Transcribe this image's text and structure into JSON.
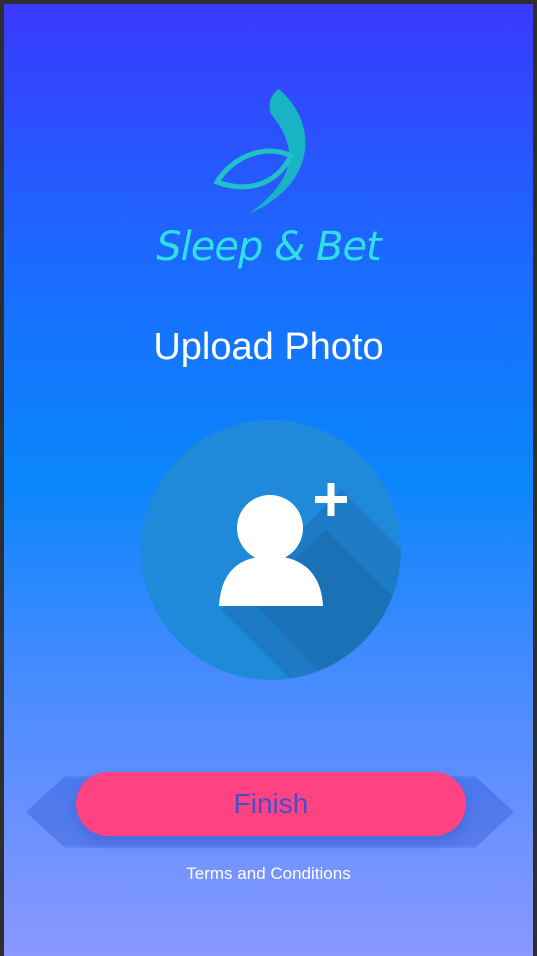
{
  "app": {
    "brand_name": "Sleep & Bet",
    "logo_icon": "butterfly-leaf-icon",
    "accent_color": "#2fe0e6"
  },
  "main": {
    "title": "Upload Photo",
    "upload_icon": "add-user-icon",
    "avatar_circle_color": "#1e8ad9"
  },
  "actions": {
    "finish_label": "Finish",
    "finish_color": "#ff4281",
    "terms_label": "Terms and Conditions"
  }
}
